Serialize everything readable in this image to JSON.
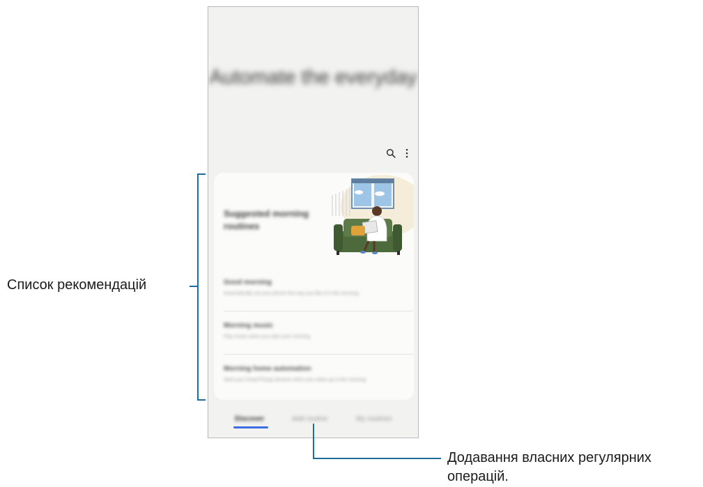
{
  "phone": {
    "hero_title": "Automate the everyday",
    "actions": {
      "search_icon": "search-icon",
      "more_icon": "more-vertical-icon"
    },
    "card": {
      "title": "Suggested morning routines",
      "items": [
        {
          "title": "Good morning",
          "subtitle": "Automatically set your phone the way you like it in the morning"
        },
        {
          "title": "Morning music",
          "subtitle": "Play music when you start your morning"
        },
        {
          "title": "Morning home automation",
          "subtitle": "Start your SmartThings devices when you wake up in the morning"
        }
      ]
    },
    "nav": {
      "tabs": [
        "Discover",
        "Add routine",
        "My routines"
      ],
      "active": 0
    }
  },
  "annotations": {
    "recommendations": "Список рекомендацій",
    "add_routines_line1": "Додавання власних регулярних",
    "add_routines_line2": "операцій."
  },
  "colors": {
    "callout_line": "#1e6d9e",
    "tab_indicator": "#3c6be6",
    "sofa": "#4c6a3b",
    "window": "#9fc5e6"
  }
}
